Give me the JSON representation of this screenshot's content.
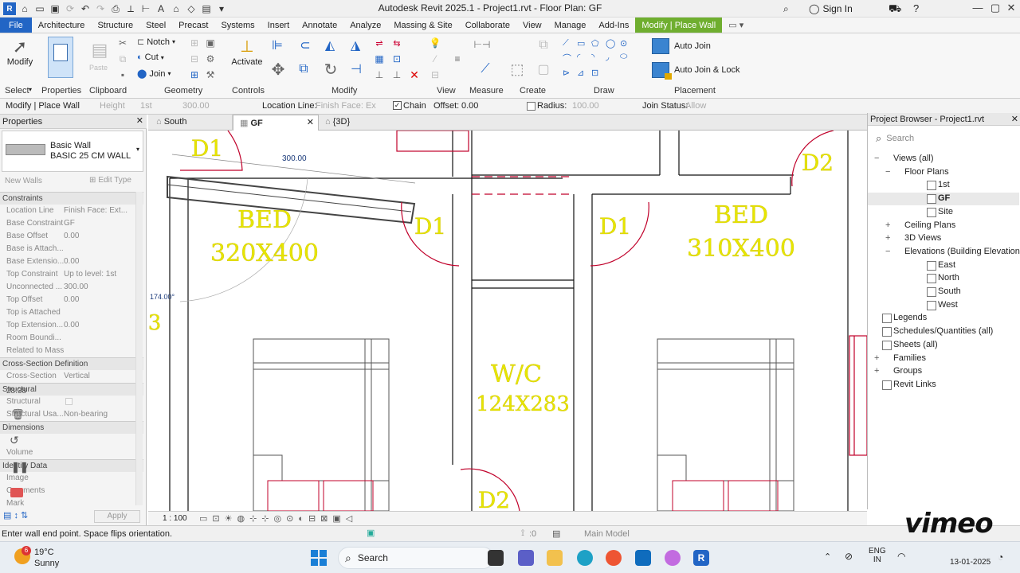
{
  "titlebar": {
    "title": "Autodesk Revit 2025.1 - Project1.rvt - Floor Plan: GF",
    "sign_in": "Sign In"
  },
  "menu": {
    "tabs": [
      "File",
      "Architecture",
      "Structure",
      "Steel",
      "Precast",
      "Systems",
      "Insert",
      "Annotate",
      "Analyze",
      "Massing & Site",
      "Collaborate",
      "View",
      "Manage",
      "Add-Ins",
      "Modify | Place Wall"
    ]
  },
  "ribbon": {
    "modify": "Modify",
    "notch": "Notch",
    "cut": "Cut",
    "join": "Join",
    "activate": "Activate",
    "auto_join": "Auto Join",
    "auto_join_lock": "Auto Join & Lock",
    "panels": [
      "Select",
      "Properties",
      "Clipboard",
      "Geometry",
      "Controls",
      "Modify",
      "View",
      "Measure",
      "Create",
      "Draw",
      "Placement"
    ],
    "paste": "Paste"
  },
  "options_bar": {
    "context": "Modify | Place Wall",
    "height_label": "Height",
    "height_level": "1st",
    "height_value": "300.00",
    "location_line_label": "Location Line:",
    "location_line_value": "Finish Face: Ex",
    "chain_label": "Chain",
    "offset_label": "Offset:",
    "offset_value": "0.00",
    "radius_label": "Radius:",
    "radius_value": "100.00",
    "join_status_label": "Join Status:",
    "join_status_value": "Allow"
  },
  "properties": {
    "title": "Properties",
    "type_family": "Basic Wall",
    "type_name": "BASIC 25 CM WALL",
    "new_walls": "New Walls",
    "edit_type": "Edit Type",
    "constraints": "Constraints",
    "rows": [
      {
        "k": "Location Line",
        "v": "Finish Face: Ext..."
      },
      {
        "k": "Base Constraint",
        "v": "GF"
      },
      {
        "k": "Base Offset",
        "v": "0.00"
      },
      {
        "k": "Base is Attach...",
        "v": ""
      },
      {
        "k": "Base Extensio...",
        "v": "0.00"
      },
      {
        "k": "Top Constraint",
        "v": "Up to level: 1st"
      },
      {
        "k": "Unconnected ...",
        "v": "300.00"
      },
      {
        "k": "Top Offset",
        "v": "0.00"
      },
      {
        "k": "Top is Attached",
        "v": ""
      },
      {
        "k": "Top Extension...",
        "v": "0.00"
      },
      {
        "k": "Room Boundi...",
        "v": ""
      },
      {
        "k": "Related to Mass",
        "v": ""
      }
    ],
    "cross_section_hdr": "Cross-Section Definition",
    "cross_section": {
      "k": "Cross-Section",
      "v": "Vertical"
    },
    "structural_hdr": "Structural",
    "structural": {
      "k": "Structural",
      "v": ""
    },
    "structural_usage": {
      "k": "Structural Usa...",
      "v": "Non-bearing"
    },
    "dimensions_hdr": "Dimensions",
    "volume": "Volume",
    "identity_hdr": "Identity Data",
    "image": "Image",
    "comments": "Comments",
    "mark": "Mark",
    "apply": "Apply",
    "overlay_time": "28:38"
  },
  "view_tabs": [
    "South",
    "GF",
    "{3D}"
  ],
  "canvas": {
    "dim_len": "300.00",
    "dim_angle": "174.00°",
    "rooms": [
      {
        "name": "BED",
        "size": "320X400"
      },
      {
        "name": "BED",
        "size": "310X400"
      },
      {
        "name": "W/C",
        "size": "124X283"
      }
    ],
    "doors": [
      "D1",
      "D1",
      "D1",
      "D2",
      "D2"
    ],
    "partial_tag": "3"
  },
  "view_control": {
    "scale": "1 : 100"
  },
  "project_browser": {
    "title": "Project Browser - Project1.rvt",
    "search": "Search",
    "items": [
      {
        "label": "Views (all)",
        "indent": 0,
        "tw": "−"
      },
      {
        "label": "Floor Plans",
        "indent": 1,
        "tw": "−"
      },
      {
        "label": "1st",
        "indent": 2,
        "tw": ""
      },
      {
        "label": "GF",
        "indent": 2,
        "tw": "",
        "sel": true
      },
      {
        "label": "Site",
        "indent": 2,
        "tw": ""
      },
      {
        "label": "Ceiling Plans",
        "indent": 1,
        "tw": "+"
      },
      {
        "label": "3D Views",
        "indent": 1,
        "tw": "+"
      },
      {
        "label": "Elevations (Building Elevation)",
        "indent": 1,
        "tw": "−"
      },
      {
        "label": "East",
        "indent": 2,
        "tw": ""
      },
      {
        "label": "North",
        "indent": 2,
        "tw": ""
      },
      {
        "label": "South",
        "indent": 2,
        "tw": ""
      },
      {
        "label": "West",
        "indent": 2,
        "tw": ""
      },
      {
        "label": "Legends",
        "indent": 0,
        "tw": ""
      },
      {
        "label": "Schedules/Quantities (all)",
        "indent": 0,
        "tw": ""
      },
      {
        "label": "Sheets (all)",
        "indent": 0,
        "tw": ""
      },
      {
        "label": "Families",
        "indent": 0,
        "tw": "+"
      },
      {
        "label": "Groups",
        "indent": 0,
        "tw": "+"
      },
      {
        "label": "Revit Links",
        "indent": 0,
        "tw": ""
      }
    ]
  },
  "status": {
    "message": "Enter wall end point. Space flips orientation.",
    "selection_count": ":0",
    "model": "Main Model"
  },
  "taskbar": {
    "weather_temp": "19°C",
    "weather_desc": "Sunny",
    "weather_badge": "6",
    "search": "Search",
    "lang": "ENG",
    "region": "IN",
    "date": "13-01-2025"
  },
  "watermark": "vimeo",
  "colors": {
    "file_tab": "#2265c5",
    "context_tab": "#6fae2f",
    "room_text": "#e6e600",
    "door": "#c0002a"
  }
}
